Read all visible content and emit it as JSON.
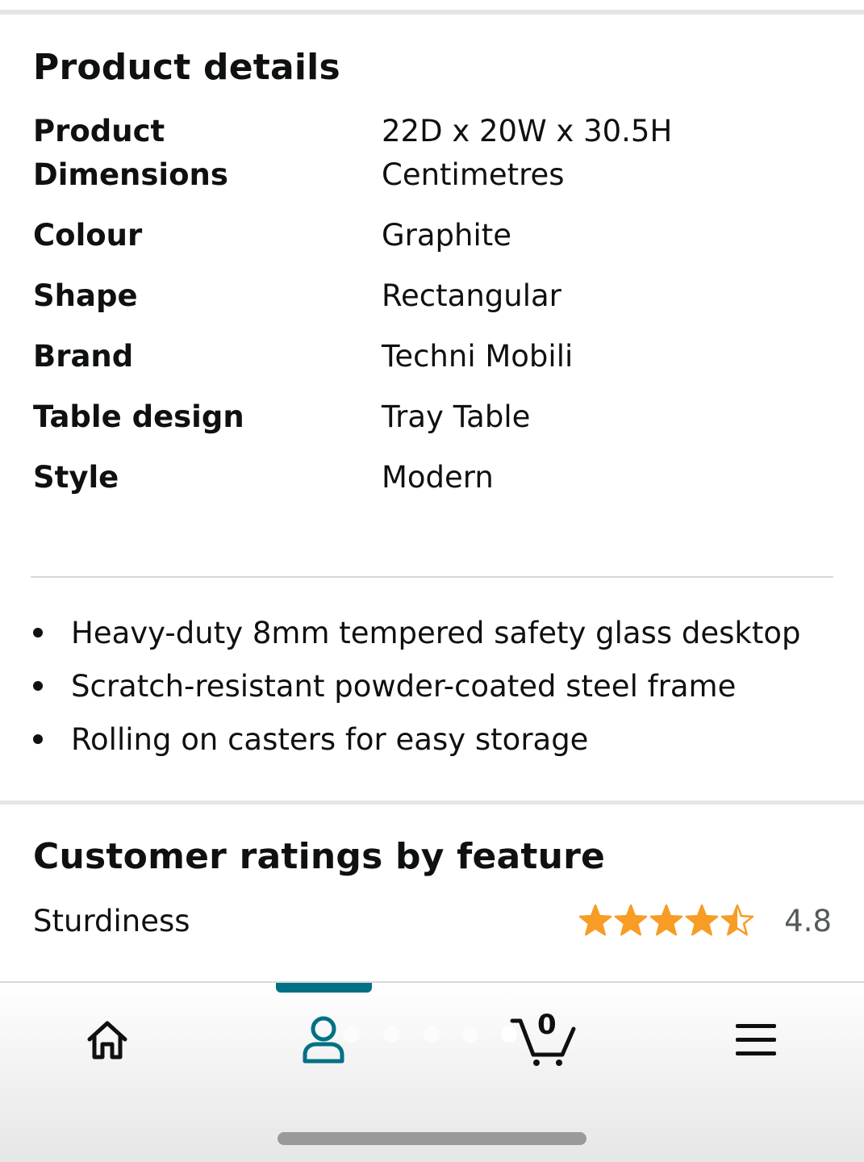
{
  "product_details": {
    "title": "Product details",
    "rows": [
      {
        "key": "Product\nDimensions",
        "value": "22D x 20W x 30.5H\nCentimetres"
      },
      {
        "key": "Colour",
        "value": "Graphite"
      },
      {
        "key": "Shape",
        "value": "Rectangular"
      },
      {
        "key": "Brand",
        "value": "Techni Mobili"
      },
      {
        "key": "Table design",
        "value": "Tray Table"
      },
      {
        "key": "Style",
        "value": "Modern"
      }
    ],
    "bullets": [
      "Heavy-duty 8mm tempered safety glass desktop",
      "Scratch-resistant powder-coated steel frame",
      "Rolling on casters for easy storage"
    ]
  },
  "customer_ratings": {
    "title": "Customer ratings by feature",
    "features": [
      {
        "name": "Sturdiness",
        "rating": 4.8,
        "rating_label": "4.8",
        "stars_filled": 4.5
      }
    ]
  },
  "nav": {
    "active_tab": "profile",
    "cart_count": "0",
    "items": [
      {
        "name": "home-icon"
      },
      {
        "name": "user-icon"
      },
      {
        "name": "cart-icon"
      },
      {
        "name": "menu-icon"
      }
    ]
  },
  "colors": {
    "star": "#F79C24",
    "accent": "#007185",
    "text": "#0F1111"
  }
}
